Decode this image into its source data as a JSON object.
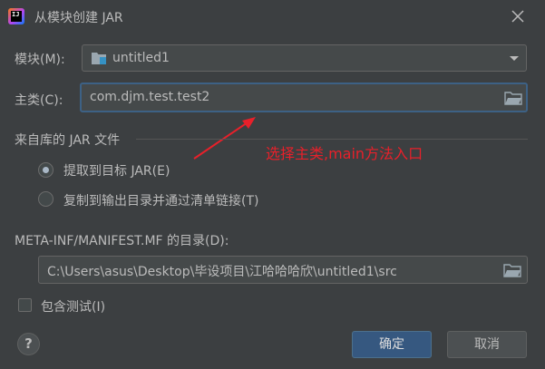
{
  "window": {
    "title": "从模块创建 JAR",
    "app_icon_text": "IJ"
  },
  "module": {
    "label": "模块(M):",
    "value": "untitled1"
  },
  "main_class": {
    "label": "主类(C):",
    "value": "com.djm.test.test2"
  },
  "annotation": {
    "text": "选择主类,main方法入口"
  },
  "library_section": {
    "title": "来自库的 JAR 文件",
    "options": [
      {
        "label": "提取到目标 JAR(E)",
        "selected": true
      },
      {
        "label": "复制到输出目录并通过清单链接(T)",
        "selected": false
      }
    ]
  },
  "manifest": {
    "label": "META-INF/MANIFEST.MF 的目录(D):",
    "value": "C:\\Users\\asus\\Desktop\\毕设项目\\江哈哈哈欣\\untitled1\\src"
  },
  "include_tests": {
    "label": "包含测试(I)",
    "checked": false
  },
  "buttons": {
    "help": "?",
    "ok": "确定",
    "cancel": "取消"
  },
  "colors": {
    "background": "#3c3f41",
    "field": "#45494a",
    "focus": "#3d6185",
    "primary_button": "#365880",
    "annotation": "#e8202a"
  }
}
